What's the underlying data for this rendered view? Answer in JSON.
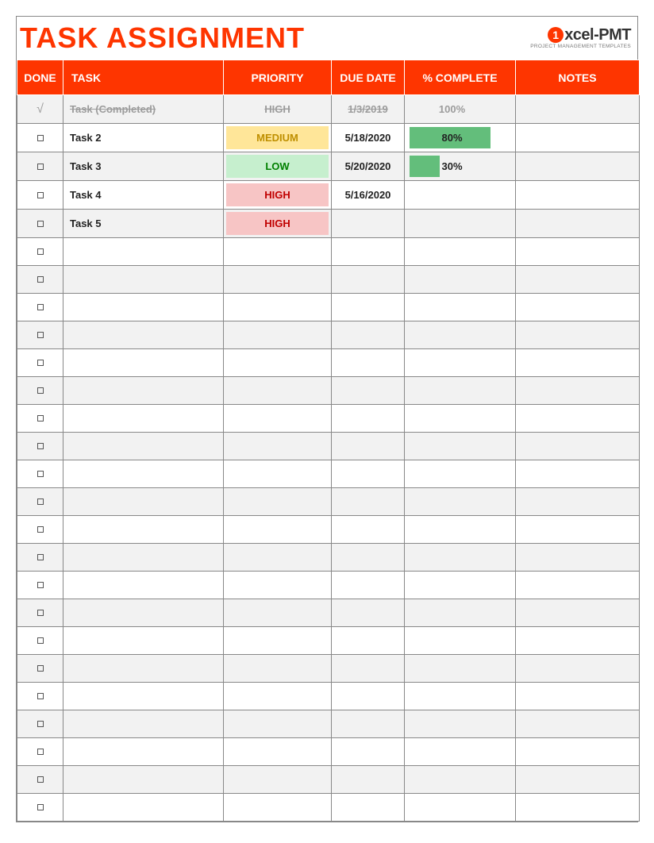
{
  "title": "TASK ASSIGNMENT",
  "logo": {
    "brand_prefix_glyph": "1",
    "brand_text": "xcel-PMT",
    "tagline": "PROJECT MANAGEMENT TEMPLATES"
  },
  "columns": {
    "done": "DONE",
    "task": "TASK",
    "priority": "PRIORITY",
    "due": "DUE DATE",
    "complete": "% COMPLETE",
    "notes": "NOTES"
  },
  "priority_labels": {
    "HIGH": "HIGH",
    "MEDIUM": "MEDIUM",
    "LOW": "LOW"
  },
  "rows": [
    {
      "done": true,
      "task": "Task (Completed)",
      "priority": "HIGH",
      "due": "1/3/2019",
      "complete": 100,
      "notes": ""
    },
    {
      "done": false,
      "task": "Task 2",
      "priority": "MEDIUM",
      "due": "5/18/2020",
      "complete": 80,
      "notes": ""
    },
    {
      "done": false,
      "task": "Task 3",
      "priority": "LOW",
      "due": "5/20/2020",
      "complete": 30,
      "notes": ""
    },
    {
      "done": false,
      "task": "Task 4",
      "priority": "HIGH",
      "due": "5/16/2020",
      "complete": null,
      "notes": ""
    },
    {
      "done": false,
      "task": "Task 5",
      "priority": "HIGH",
      "due": "",
      "complete": null,
      "notes": ""
    },
    {
      "done": false,
      "task": "",
      "priority": "",
      "due": "",
      "complete": null,
      "notes": ""
    },
    {
      "done": false,
      "task": "",
      "priority": "",
      "due": "",
      "complete": null,
      "notes": ""
    },
    {
      "done": false,
      "task": "",
      "priority": "",
      "due": "",
      "complete": null,
      "notes": ""
    },
    {
      "done": false,
      "task": "",
      "priority": "",
      "due": "",
      "complete": null,
      "notes": ""
    },
    {
      "done": false,
      "task": "",
      "priority": "",
      "due": "",
      "complete": null,
      "notes": ""
    },
    {
      "done": false,
      "task": "",
      "priority": "",
      "due": "",
      "complete": null,
      "notes": ""
    },
    {
      "done": false,
      "task": "",
      "priority": "",
      "due": "",
      "complete": null,
      "notes": ""
    },
    {
      "done": false,
      "task": "",
      "priority": "",
      "due": "",
      "complete": null,
      "notes": ""
    },
    {
      "done": false,
      "task": "",
      "priority": "",
      "due": "",
      "complete": null,
      "notes": ""
    },
    {
      "done": false,
      "task": "",
      "priority": "",
      "due": "",
      "complete": null,
      "notes": ""
    },
    {
      "done": false,
      "task": "",
      "priority": "",
      "due": "",
      "complete": null,
      "notes": ""
    },
    {
      "done": false,
      "task": "",
      "priority": "",
      "due": "",
      "complete": null,
      "notes": ""
    },
    {
      "done": false,
      "task": "",
      "priority": "",
      "due": "",
      "complete": null,
      "notes": ""
    },
    {
      "done": false,
      "task": "",
      "priority": "",
      "due": "",
      "complete": null,
      "notes": ""
    },
    {
      "done": false,
      "task": "",
      "priority": "",
      "due": "",
      "complete": null,
      "notes": ""
    },
    {
      "done": false,
      "task": "",
      "priority": "",
      "due": "",
      "complete": null,
      "notes": ""
    },
    {
      "done": false,
      "task": "",
      "priority": "",
      "due": "",
      "complete": null,
      "notes": ""
    },
    {
      "done": false,
      "task": "",
      "priority": "",
      "due": "",
      "complete": null,
      "notes": ""
    },
    {
      "done": false,
      "task": "",
      "priority": "",
      "due": "",
      "complete": null,
      "notes": ""
    },
    {
      "done": false,
      "task": "",
      "priority": "",
      "due": "",
      "complete": null,
      "notes": ""
    },
    {
      "done": false,
      "task": "",
      "priority": "",
      "due": "",
      "complete": null,
      "notes": ""
    }
  ],
  "glyphs": {
    "check": "√"
  }
}
